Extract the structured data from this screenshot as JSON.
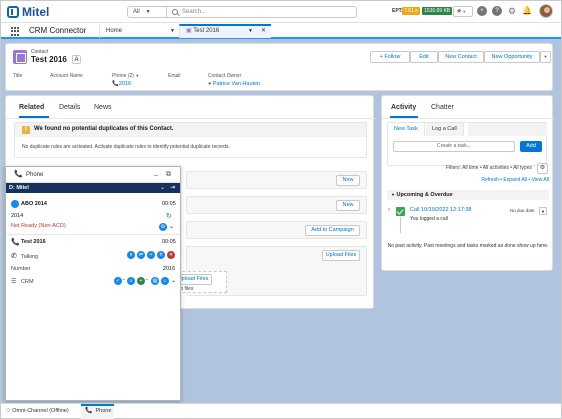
{
  "header": {
    "logo_text": "Mitel",
    "scope_label": "All",
    "search_placeholder": "Search...",
    "ept_label": "EPT:",
    "ept_badge1": "7.61 s",
    "ept_badge2": "1536.69 KB"
  },
  "nav": {
    "app_name": "CRM Connector",
    "tabs": [
      {
        "label": "Home"
      },
      {
        "label": "Test 2016"
      }
    ]
  },
  "record": {
    "object_label": "Contact",
    "name": "Test 2016",
    "buttons": [
      "Follow",
      "Edit",
      "New Contact",
      "New Opportunity"
    ],
    "fields": [
      {
        "label": "Title",
        "value": ""
      },
      {
        "label": "Account Name",
        "value": ""
      },
      {
        "label": "Phone (2)",
        "value": "2016"
      },
      {
        "label": "Email",
        "value": ""
      },
      {
        "label": "Contact Owner",
        "value": "Patrice Van Hauten"
      }
    ]
  },
  "left_tabs": [
    "Related",
    "Details",
    "News"
  ],
  "duplicates": {
    "title": "We found no potential duplicates of this Contact.",
    "text": "No duplicate rules are activated. Activate duplicate rules to identify potential duplicate records."
  },
  "related_buttons": {
    "new1": "New",
    "new2": "New",
    "add_campaign": "Add to Campaign",
    "upload_files": "Upload Files",
    "upload_files2": "Upload Files",
    "drop_files": "r drop files"
  },
  "activity": {
    "tabs": [
      "Activity",
      "Chatter"
    ],
    "subtabs": [
      "New Task",
      "Log a Call"
    ],
    "create_placeholder": "Create a task...",
    "add_label": "Add",
    "filters": "Filters: All time • All activities • All types",
    "links": "Refresh • Expand All • View All",
    "upcoming": "Upcoming & Overdue",
    "task_title": "Call 10/19/2022 12:17:38",
    "task_sub": "You logged a call",
    "no_due": "No due date",
    "no_activity": "No past activity. Past meetings and tasks marked as done show up here."
  },
  "phone": {
    "title": "Phone",
    "brand": "Mitel",
    "agent_name": "ABO 2014",
    "agent_time": "00:05",
    "agent_ext": "2014",
    "agent_status": "Not Ready (Non-ACD)",
    "call_name": "Test 2016",
    "call_time": "00:05",
    "call_status": "Talking",
    "number_label": "Number",
    "number_value": "2016",
    "crm_label": "CRM"
  },
  "utility": {
    "omni": "Omni-Channel (Offline)",
    "phone": "Phone"
  }
}
